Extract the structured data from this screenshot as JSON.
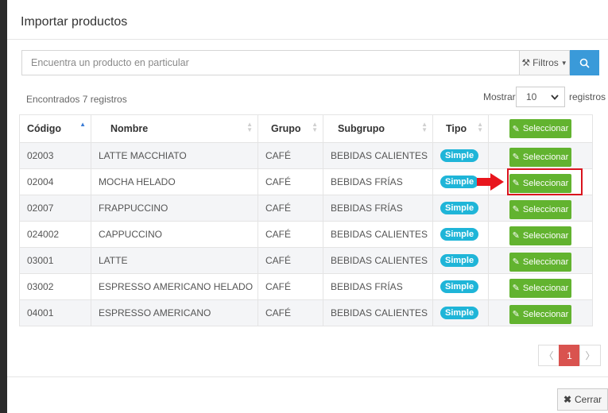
{
  "modal": {
    "title": "Importar productos"
  },
  "search": {
    "placeholder": "Encuentra un producto en particular",
    "value": ""
  },
  "toolbar": {
    "filters_label": "Filtros",
    "filters_icon": "wrench-icon",
    "search_icon": "magnifier-icon"
  },
  "results": {
    "found_text": "Encontrados 7 registros",
    "show_label": "Mostrar",
    "page_size": "10",
    "show_suffix": "registros"
  },
  "table": {
    "headers": {
      "codigo": "Código",
      "nombre": "Nombre",
      "grupo": "Grupo",
      "subgrupo": "Subgrupo",
      "tipo": "Tipo",
      "select_all": "Seleccionar"
    },
    "rows": [
      {
        "codigo": "02003",
        "nombre": "LATTE MACCHIATO",
        "grupo": "CAFÉ",
        "subgrupo": "BEBIDAS CALIENTES",
        "tipo": "Simple",
        "action": "Seleccionar"
      },
      {
        "codigo": "02004",
        "nombre": "MOCHA HELADO",
        "grupo": "CAFÉ",
        "subgrupo": "BEBIDAS FRÍAS",
        "tipo": "Simple",
        "action": "Seleccionar"
      },
      {
        "codigo": "02007",
        "nombre": "FRAPPUCCINO",
        "grupo": "CAFÉ",
        "subgrupo": "BEBIDAS FRÍAS",
        "tipo": "Simple",
        "action": "Seleccionar"
      },
      {
        "codigo": "024002",
        "nombre": "CAPPUCCINO",
        "grupo": "CAFÉ",
        "subgrupo": "BEBIDAS CALIENTES",
        "tipo": "Simple",
        "action": "Seleccionar"
      },
      {
        "codigo": "03001",
        "nombre": "LATTE",
        "grupo": "CAFÉ",
        "subgrupo": "BEBIDAS CALIENTES",
        "tipo": "Simple",
        "action": "Seleccionar"
      },
      {
        "codigo": "03002",
        "nombre": "ESPRESSO AMERICANO HELADO",
        "grupo": "CAFÉ",
        "subgrupo": "BEBIDAS FRÍAS",
        "tipo": "Simple",
        "action": "Seleccionar"
      },
      {
        "codigo": "04001",
        "nombre": "ESPRESSO AMERICANO",
        "grupo": "CAFÉ",
        "subgrupo": "BEBIDAS CALIENTES",
        "tipo": "Simple",
        "action": "Seleccionar"
      }
    ]
  },
  "pagination": {
    "prev": "〈",
    "current": "1",
    "next": "〉"
  },
  "footer": {
    "close_label": "Cerrar",
    "close_icon": "close-icon"
  },
  "colors": {
    "primary": "#3a9ad9",
    "success": "#62b32f",
    "info_badge": "#1fb5d8",
    "highlight": "#d9141e",
    "pager_active": "#d9534f"
  }
}
